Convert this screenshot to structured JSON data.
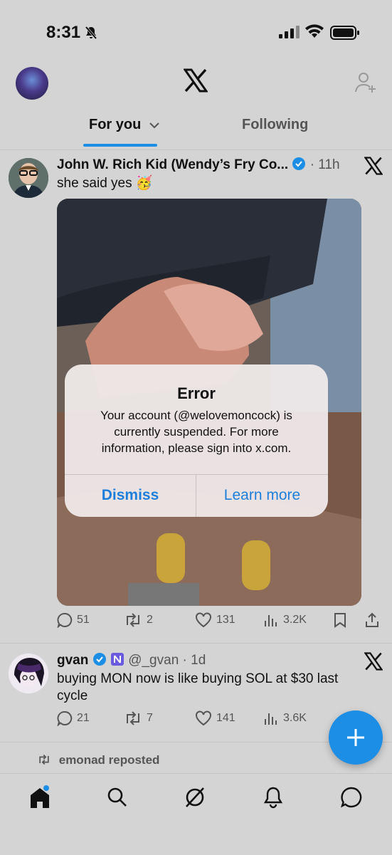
{
  "status_bar": {
    "time": "8:31"
  },
  "header": {
    "tabs": [
      {
        "label": "For you"
      },
      {
        "label": "Following"
      }
    ]
  },
  "posts": [
    {
      "display_name": "John W. Rich Kid (Wendy’s Fry Co...",
      "meta": "· 11h",
      "text": "she said yes 🥳",
      "stats": {
        "replies": "51",
        "reposts": "2",
        "likes": "131",
        "views": "3.2K"
      }
    },
    {
      "display_name": "gvan",
      "handle": "@_gvan · 1d",
      "text_line1": "buying MON now is like buying SOL at $30 last",
      "text_line2": "cycle",
      "stats": {
        "replies": "21",
        "reposts": "7",
        "likes": "141",
        "views": "3.6K"
      }
    }
  ],
  "repost_notice": "emonad reposted",
  "alert": {
    "title": "Error",
    "message_line1": "Your account (@welovemoncock) is",
    "message_line2": "currently suspended. For more",
    "message_line3": "information, please sign into x.com.",
    "dismiss_label": "Dismiss",
    "learn_more_label": "Learn more"
  },
  "colors": {
    "accent": "#1d8ee6",
    "background": "#d4d4d4",
    "verified": "#1d8ee6"
  },
  "icons": [
    "bell-slash-icon",
    "signal-icon",
    "wifi-icon",
    "battery-icon",
    "x-logo-icon",
    "add-user-icon",
    "chevron-down-icon",
    "reply-icon",
    "repost-icon",
    "like-icon",
    "views-icon",
    "bookmark-icon",
    "share-icon",
    "home-icon",
    "search-icon",
    "grok-icon",
    "notifications-icon",
    "messages-icon",
    "compose-icon"
  ]
}
